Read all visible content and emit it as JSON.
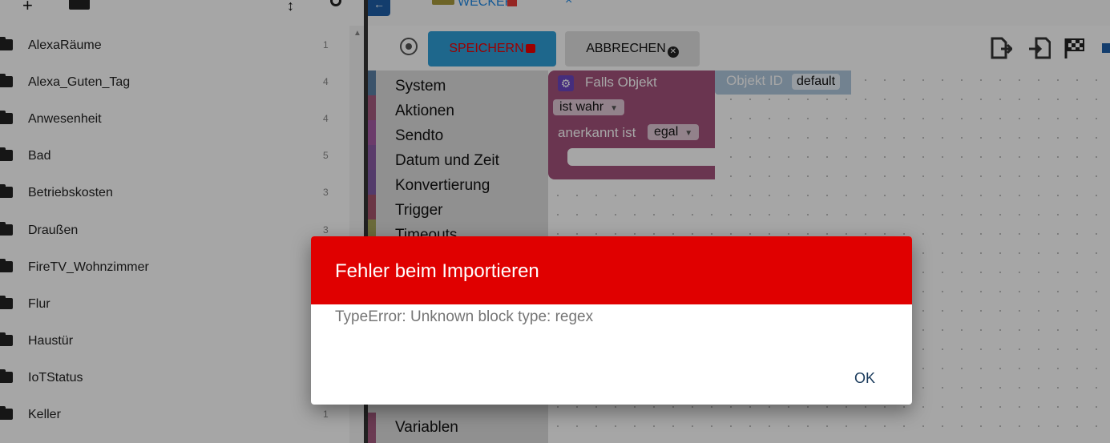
{
  "tree": {
    "items": [
      {
        "label": "AlexaRäume",
        "count": "1"
      },
      {
        "label": "Alexa_Guten_Tag",
        "count": "4"
      },
      {
        "label": "Anwesenheit",
        "count": "4"
      },
      {
        "label": "Bad",
        "count": "5"
      },
      {
        "label": "Betriebskosten",
        "count": "3"
      },
      {
        "label": "Draußen",
        "count": "3"
      },
      {
        "label": "FireTV_Wohnzimmer",
        "count": ""
      },
      {
        "label": "Flur",
        "count": ""
      },
      {
        "label": "Haustür",
        "count": ""
      },
      {
        "label": "IoTStatus",
        "count": ""
      },
      {
        "label": "Keller",
        "count": "1"
      }
    ]
  },
  "tabs": {
    "active_label": "WECKER",
    "close_glyph": "×"
  },
  "toolbar": {
    "save_label": "SPEICHERN",
    "cancel_label": "ABBRECHEN"
  },
  "toolbox": {
    "categories": [
      {
        "label": "System",
        "color": "#5b80a5"
      },
      {
        "label": "Aktionen",
        "color": "#a55b80"
      },
      {
        "label": "Sendto",
        "color": "#a55ba5"
      },
      {
        "label": "Datum und Zeit",
        "color": "#8a5ba5"
      },
      {
        "label": "Konvertierung",
        "color": "#805ba5"
      },
      {
        "label": "Trigger",
        "color": "#a5536a"
      },
      {
        "label": "Timeouts",
        "color": "#a5a55b"
      },
      {
        "label": "Variablen",
        "color": "#a55b80"
      }
    ]
  },
  "workspace": {
    "block_title": "Falls Objekt",
    "is_label": "ist wahr",
    "ack_label": "anerkannt ist",
    "ack_value": "egal",
    "object_label": "Objekt ID",
    "object_value": "default"
  },
  "dialog": {
    "title": "Fehler beim Importieren",
    "message": "TypeError: Unknown block type: regex",
    "ok_label": "OK"
  },
  "colors": {
    "dialog_header": "#e00000",
    "save_button": "#2e9fd8",
    "accent": "#1e88e5"
  }
}
